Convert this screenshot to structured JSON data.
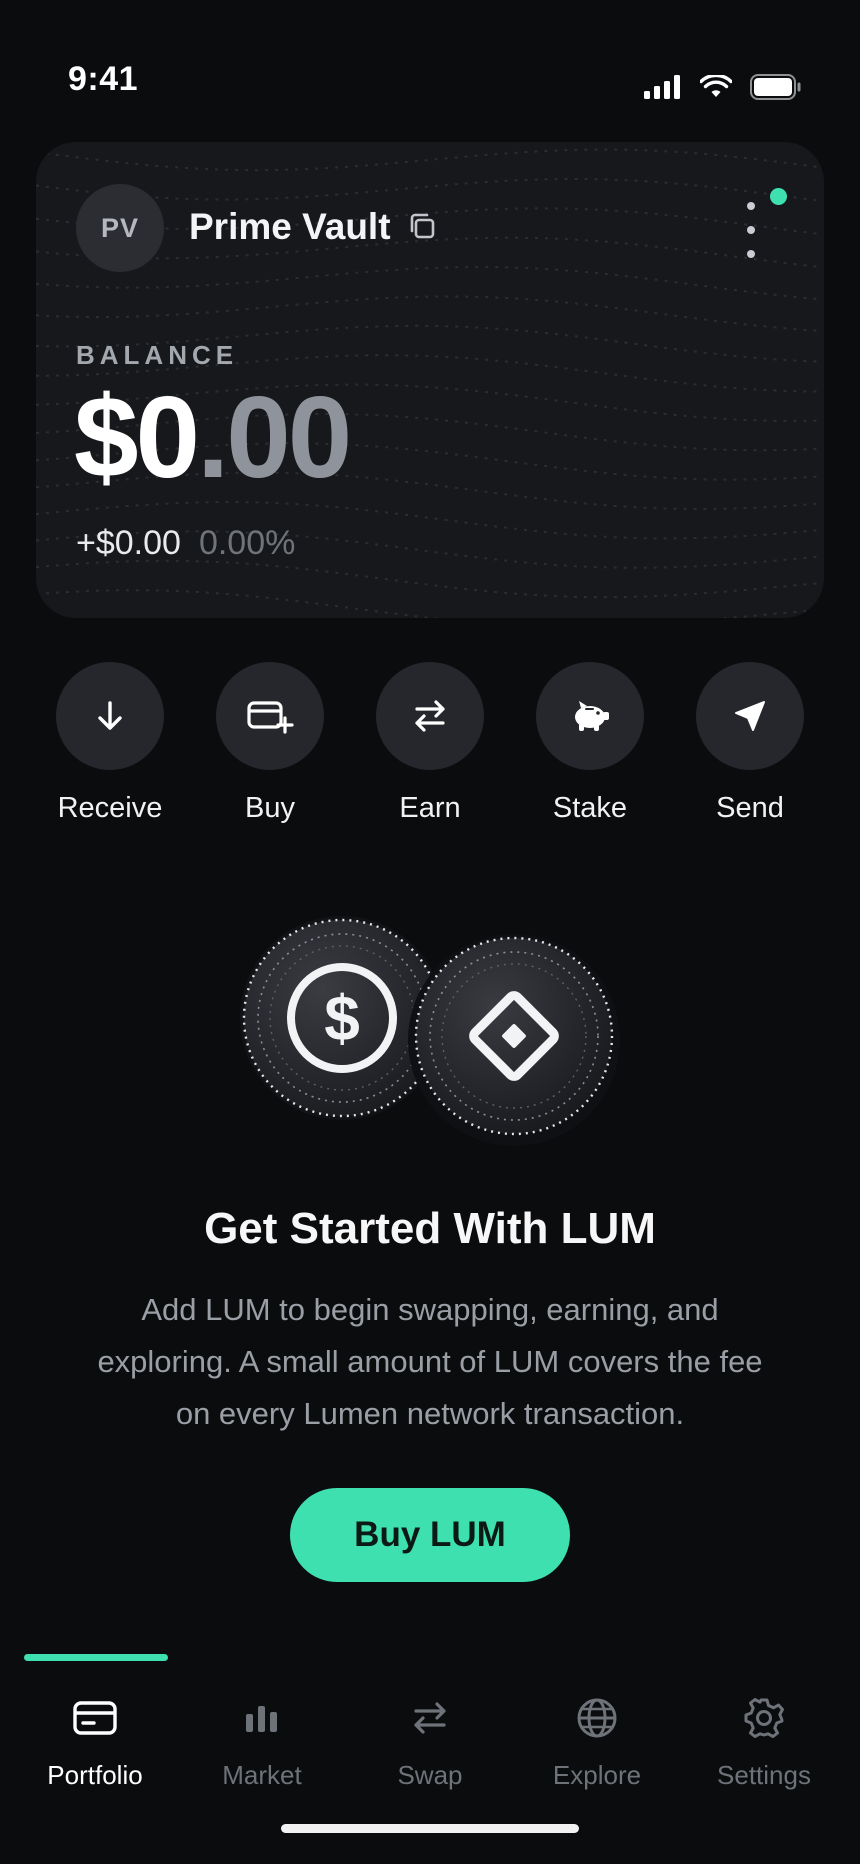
{
  "status_bar": {
    "time": "9:41",
    "icons": [
      "cellular-signal-icon",
      "wifi-icon",
      "battery-icon"
    ]
  },
  "wallet": {
    "avatar_initials": "PV",
    "name": "Prime Vault",
    "balance_label": "BALANCE",
    "balance_main": "$0",
    "balance_fraction": ".00",
    "change_amount": "+$0.00",
    "change_percent": "0.00%",
    "status_color": "#3fe0b0"
  },
  "actions": [
    {
      "label": "Receive",
      "icon": "arrow-down-icon"
    },
    {
      "label": "Buy",
      "icon": "card-plus-icon"
    },
    {
      "label": "Earn",
      "icon": "swap-arrows-icon"
    },
    {
      "label": "Stake",
      "icon": "piggy-bank-icon"
    },
    {
      "label": "Send",
      "icon": "send-arrow-icon"
    }
  ],
  "cta": {
    "title": "Get Started With LUM",
    "body": "Add LUM to begin swapping, earning, and exploring. A small amount of LUM covers the fee on every Lumen network transaction.",
    "button_label": "Buy LUM",
    "accent": "#3fe0b0"
  },
  "tabs": [
    {
      "label": "Portfolio",
      "icon": "card-icon",
      "active": true
    },
    {
      "label": "Market",
      "icon": "bar-chart-icon",
      "active": false
    },
    {
      "label": "Swap",
      "icon": "swap-arrows-icon",
      "active": false
    },
    {
      "label": "Explore",
      "icon": "globe-icon",
      "active": false
    },
    {
      "label": "Settings",
      "icon": "gear-icon",
      "active": false
    }
  ]
}
